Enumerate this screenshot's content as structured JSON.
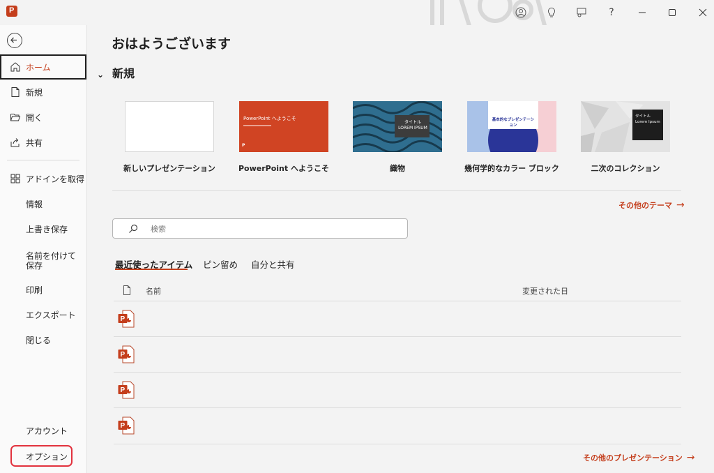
{
  "app": {
    "logo_letter": "P"
  },
  "sidebar": {
    "items": [
      {
        "label": "ホーム",
        "icon": "home-icon"
      },
      {
        "label": "新規",
        "icon": "new-file-icon"
      },
      {
        "label": "開く",
        "icon": "folder-open-icon"
      },
      {
        "label": "共有",
        "icon": "share-icon"
      },
      {
        "label": "アドインを取得",
        "icon": "add-ins-icon"
      },
      {
        "label": "情報"
      },
      {
        "label": "上書き保存"
      },
      {
        "label": "名前を付けて保存"
      },
      {
        "label": "印刷"
      },
      {
        "label": "エクスポート"
      },
      {
        "label": "閉じる"
      }
    ],
    "account": "アカウント",
    "options": "オプション"
  },
  "main": {
    "greeting": "おはようございます",
    "new_section": "新規",
    "templates": [
      {
        "name": "新しいプレゼンテーション",
        "thumb_text": ""
      },
      {
        "name": "PowerPoint へようこそ",
        "thumb_text": "PowerPoint へようこそ"
      },
      {
        "name": "織物",
        "thumb_text": "タイトル LOREM IPSUM"
      },
      {
        "name": "幾何学的なカラー ブロック",
        "thumb_text": "基本的なプレゼンテーション"
      },
      {
        "name": "二次のコレクション",
        "thumb_text": "タイトル Lorem Ipsum"
      }
    ],
    "more_themes": "その他のテーマ",
    "search_placeholder": "検索",
    "tabs": [
      "最近使ったアイテム",
      "ピン留め",
      "自分と共有"
    ],
    "columns": {
      "name": "名前",
      "modified": "変更された日"
    },
    "recent_files": [
      {
        "name": "",
        "modified": ""
      },
      {
        "name": "",
        "modified": ""
      },
      {
        "name": "",
        "modified": ""
      },
      {
        "name": "",
        "modified": ""
      }
    ],
    "more_presentations": "その他のプレゼンテーション"
  },
  "colors": {
    "accent": "#c43e1c",
    "highlight": "#e2323e"
  }
}
